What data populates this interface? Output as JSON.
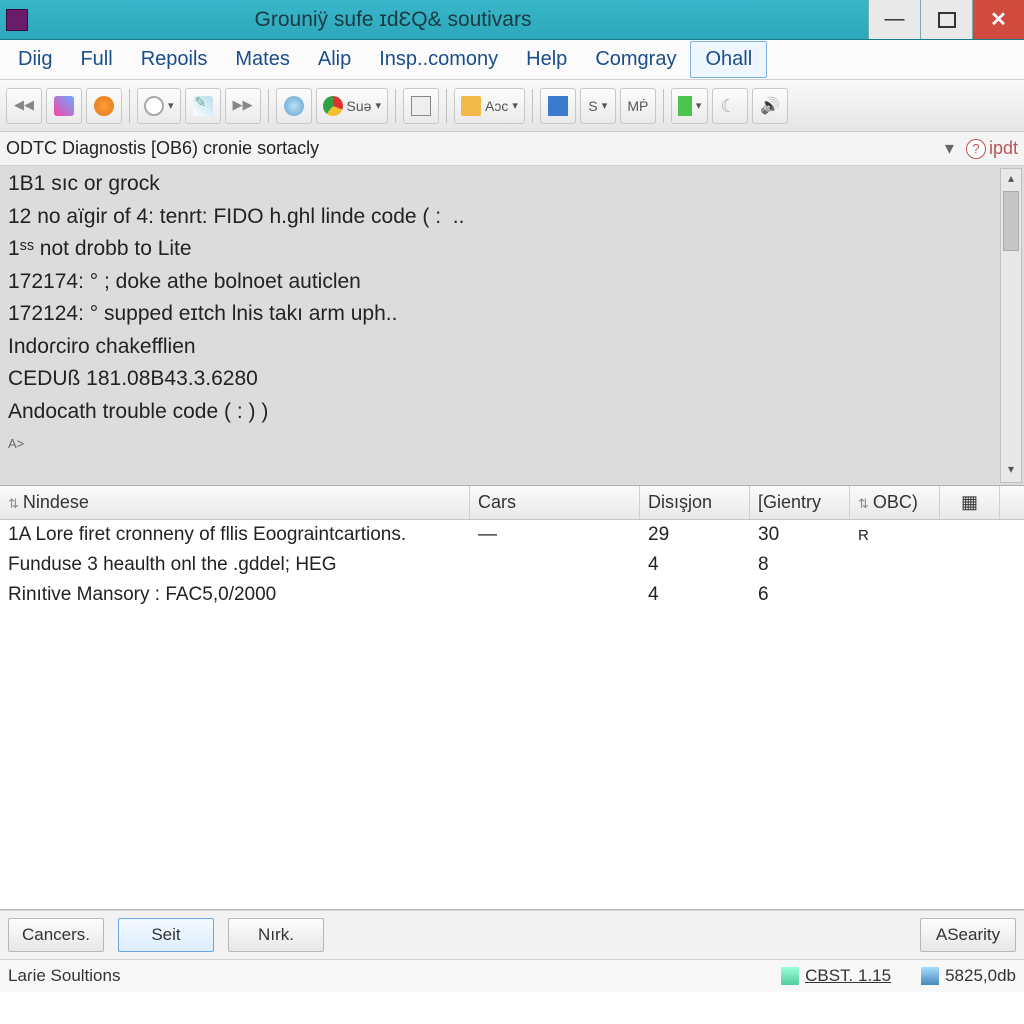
{
  "window": {
    "title": "Grouniÿ sufe ɪdƐQ& soutivars"
  },
  "menu": {
    "items": [
      "Diig",
      "Full",
      "Repoils",
      "Mates",
      "Alip",
      "Insp..comony",
      "Help",
      "Comgray",
      "Ohall"
    ],
    "active_index": 8
  },
  "toolbar": {
    "combo1": "Suə",
    "combo2": "Aɔc",
    "btn_s": "S",
    "btn_mp": "MṖ"
  },
  "pathbar": {
    "path": "ODTC Diagnostis [OB6) cronie sortacly",
    "help": "ipdt"
  },
  "output": {
    "lines": [
      "1B1 sıc or grock",
      "12 no aïgir of 4: tenrt: FIDO h.ghl linde code ( :  ..",
      "1ˢˢ not drobb to Lite",
      "172174: ° ; doke athe bolnoet auticlen",
      "172124: ° supped eɪtch lnis takı arm uph..",
      "Indoɾciro chakefflien",
      "CEDUß 181.08B43.3.6280",
      "Andocath trouble code ( : ) )"
    ],
    "prompt": "A>"
  },
  "table": {
    "columns": {
      "nind": "Nindese",
      "cars": "Cars",
      "dis": "Disışjon",
      "gie": "[Gientry",
      "obc": "OBC)"
    },
    "rows": [
      {
        "nind": "1A Lore firet cronneny of fllis Eoograintcartions.",
        "cars": "—",
        "dis": "29",
        "gie": "30",
        "obc": "R"
      },
      {
        "nind": "Funduse 3 heaulth onl the .gddel; HEG",
        "cars": "",
        "dis": "4",
        "gie": "8",
        "obc": ""
      },
      {
        "nind": "Rinıtive Mansory : FAC5,0/2000",
        "cars": "",
        "dis": "4",
        "gie": "6",
        "obc": ""
      }
    ]
  },
  "buttons": {
    "cancel": "Cancers.",
    "set": "Seit",
    "nrk": "Nırk.",
    "asearty": "ASearity"
  },
  "status": {
    "left": "Laɾie Soultions",
    "chip1": "CBST. 1.15",
    "chip2": "5825,0db"
  }
}
